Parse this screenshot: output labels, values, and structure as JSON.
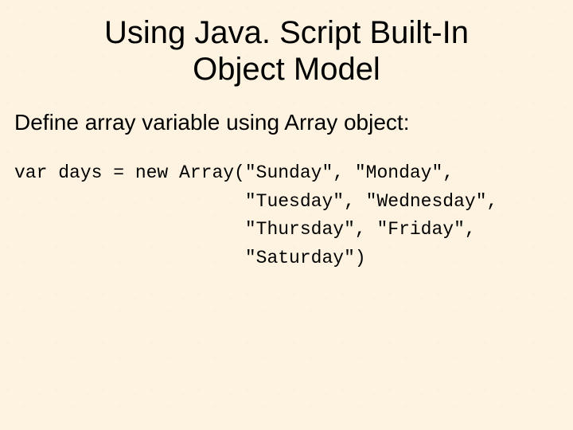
{
  "title_line1": "Using Java. Script Built-In",
  "title_line2": "Object Model",
  "subtitle": "Define array variable using Array object:",
  "code_line1": "var days = new Array(\"Sunday\", \"Monday\",",
  "code_line2": "                     \"Tuesday\", \"Wednesday\",",
  "code_line3": "                     \"Thursday\", \"Friday\",",
  "code_line4": "                     \"Saturday\")"
}
